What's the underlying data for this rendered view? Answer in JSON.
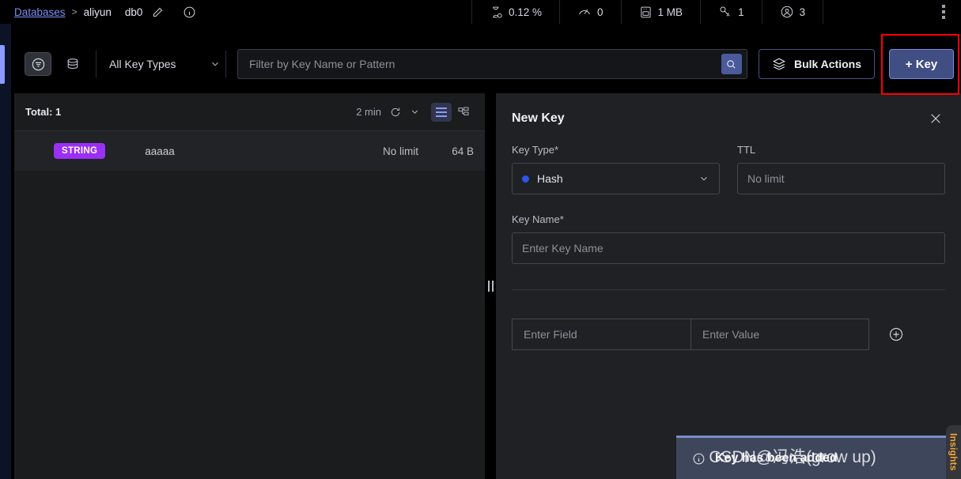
{
  "breadcrumb": {
    "databases_link": "Databases",
    "separator": ">",
    "environment": "aliyun",
    "database": "db0",
    "edit_icon": "pencil-icon",
    "info_icon": "info-circle-icon"
  },
  "stats": [
    {
      "icon": "cpu-hourglass-icon",
      "value": "0.12 %"
    },
    {
      "icon": "speedometer-icon",
      "value": "0"
    },
    {
      "icon": "memory-card-icon",
      "value": "1 MB"
    },
    {
      "icon": "key-icon",
      "value": "1"
    },
    {
      "icon": "user-circle-icon",
      "value": "3"
    }
  ],
  "more_menu_icon": "kebab-menu-icon",
  "toolbar": {
    "filter_icon": "filter-circle-icon",
    "database_icon": "database-stack-icon",
    "key_types_label": "All Key Types",
    "key_types_chevron": "chevron-down-icon",
    "search_placeholder": "Filter by Key Name or Pattern",
    "search_value": "",
    "search_icon": "search-icon",
    "bulk_actions_label": "Bulk Actions",
    "bulk_actions_icon": "layers-icon",
    "add_key_label": "+ Key"
  },
  "keys_panel": {
    "total_label": "Total: 1",
    "refresh_time": "2 min",
    "refresh_icon": "refresh-icon",
    "refresh_chevron": "chevron-down-icon",
    "list_view_icon": "list-view-icon",
    "tree_view_icon": "tree-view-icon",
    "rows": [
      {
        "type": "STRING",
        "name": "aaaaa",
        "ttl": "No limit",
        "size": "64 B"
      }
    ]
  },
  "splitter": {
    "handle_icon": "drag-handle-icon"
  },
  "new_key": {
    "title": "New Key",
    "close_icon": "close-icon",
    "key_type_label": "Key Type*",
    "key_type_value": "Hash",
    "key_type_dot_color": "#2f54eb",
    "key_type_chevron": "chevron-down-icon",
    "ttl_label": "TTL",
    "ttl_placeholder": "No limit",
    "ttl_value": "",
    "key_name_label": "Key Name*",
    "key_name_placeholder": "Enter Key Name",
    "key_name_value": "",
    "field_placeholder": "Enter Field",
    "field_value": "",
    "value_placeholder": "Enter Value",
    "value_value": "",
    "add_row_icon": "plus-circle-icon"
  },
  "toast": {
    "icon": "info-circle-icon",
    "message": "Key has been added"
  },
  "watermark": {
    "text": "CSDN@冯浩(grow up)"
  },
  "insights": {
    "label": "Insights"
  },
  "colors": {
    "accent_blue": "#8a9bff",
    "primary_button": "#414e84",
    "string_badge": "#9b2ff5",
    "toast_bg": "#3e465c",
    "highlight_box": "#fe0000",
    "insights_text": "#f0a43a"
  }
}
